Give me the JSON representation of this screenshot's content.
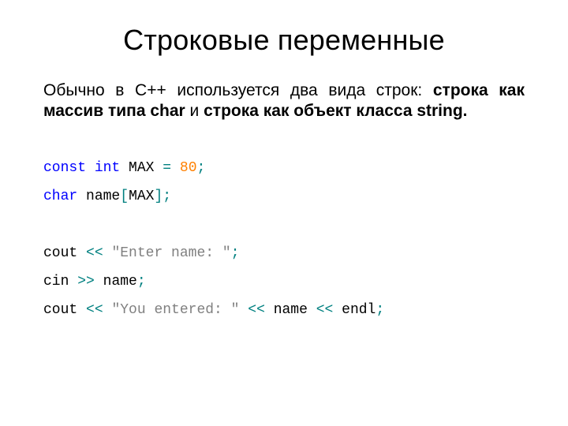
{
  "title": "Строковые переменные",
  "body": {
    "part1": "Обычно в C++ используется два вида строк: ",
    "bold1": "строка как массив типа char",
    "part2": " и ",
    "bold2": "строка как объект класса string.",
    "part3": ""
  },
  "code": {
    "l1": {
      "kw_const": "const",
      "sp1": " ",
      "kw_int": "int",
      "sp2": " ",
      "id": "MAX ",
      "eq": "=",
      "sp3": " ",
      "num": "80",
      "semi": ";"
    },
    "l2": {
      "kw_char": "char",
      "sp1": " ",
      "id": "name",
      "lb": "[",
      "idx": "MAX",
      "rb": "]",
      "semi": ";"
    },
    "blank1": " ",
    "l3": {
      "id": "cout ",
      "op1": "<<",
      "sp1": " ",
      "str": "\"Enter name: \"",
      "semi": ";"
    },
    "l4": {
      "id": "cin ",
      "op1": ">>",
      "sp1": " ",
      "id2": "name",
      "semi": ";"
    },
    "l5": {
      "id": "cout ",
      "op1": "<<",
      "sp1": " ",
      "str": "\"You entered: \"",
      "sp2": " ",
      "op2": "<<",
      "sp3": " ",
      "id2": "name ",
      "op3": "<<",
      "sp4": " ",
      "id3": "endl",
      "semi": ";"
    }
  }
}
